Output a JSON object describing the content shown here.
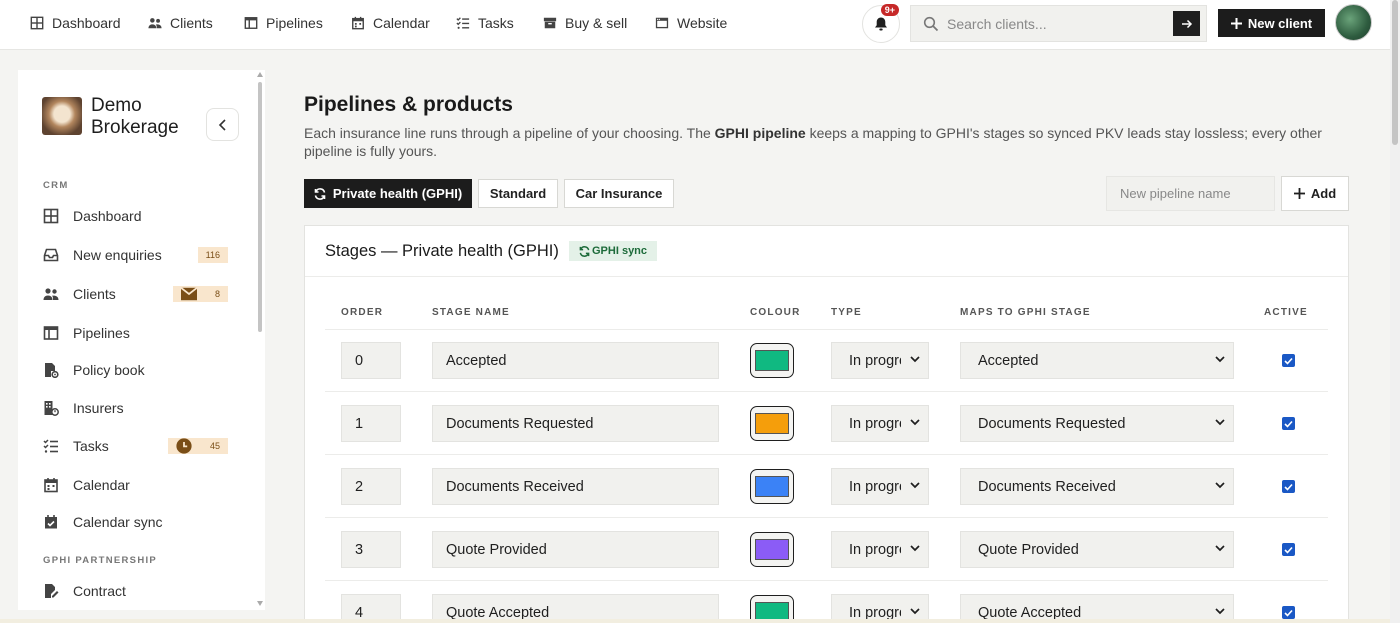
{
  "nav": {
    "items": [
      {
        "label": "Dashboard",
        "icon": "grid-icon"
      },
      {
        "label": "Clients",
        "icon": "users-icon"
      },
      {
        "label": "Pipelines",
        "icon": "columns-icon"
      },
      {
        "label": "Calendar",
        "icon": "calendar-icon"
      },
      {
        "label": "Tasks",
        "icon": "checklist-icon"
      },
      {
        "label": "Buy & sell",
        "icon": "box-icon"
      },
      {
        "label": "Website",
        "icon": "browser-icon"
      }
    ],
    "notification_badge": "9+",
    "search_placeholder": "Search clients...",
    "new_client_label": "New client"
  },
  "sidebar": {
    "brand_line1": "Demo",
    "brand_line2": "Brokerage",
    "section_crm": "CRM",
    "items": [
      {
        "label": "Dashboard",
        "icon": "grid-icon"
      },
      {
        "label": "New enquiries",
        "icon": "inbox-icon",
        "badge": "116"
      },
      {
        "label": "Clients",
        "icon": "users-icon",
        "badge": "8",
        "badge_icon": "mail-icon"
      },
      {
        "label": "Pipelines",
        "icon": "columns-icon"
      },
      {
        "label": "Policy book",
        "icon": "file-gear-icon"
      },
      {
        "label": "Insurers",
        "icon": "building-icon"
      },
      {
        "label": "Tasks",
        "icon": "checklist-icon",
        "badge": "45",
        "badge_icon": "clock-icon"
      },
      {
        "label": "Calendar",
        "icon": "calendar-icon"
      },
      {
        "label": "Calendar sync",
        "icon": "calendar-check-icon"
      }
    ],
    "section_partner": "GPHI PARTNERSHIP",
    "partner_items": [
      {
        "label": "Contract",
        "icon": "file-signature-icon"
      }
    ]
  },
  "page": {
    "title": "Pipelines & products",
    "desc_before": "Each insurance line runs through a pipeline of your choosing. The ",
    "desc_bold": "GPHI pipeline",
    "desc_after": " keeps a mapping to GPHI's stages so synced PKV leads stay lossless; every other pipeline is fully yours.",
    "tabs": [
      {
        "label": "Private health (GPHI)",
        "active": true
      },
      {
        "label": "Standard",
        "active": false
      },
      {
        "label": "Car Insurance",
        "active": false
      }
    ],
    "new_pipeline_placeholder": "New pipeline name",
    "add_label": "Add"
  },
  "stages": {
    "title": "Stages — Private health (GPHI)",
    "sync_badge": "GPHI sync",
    "columns": [
      "ORDER",
      "STAGE NAME",
      "COLOUR",
      "TYPE",
      "MAPS TO GPHI STAGE",
      "ACTIVE"
    ],
    "rows": [
      {
        "order": "0",
        "name": "Accepted",
        "colour": "#10b981",
        "type": "In progress",
        "maps_to": "Accepted",
        "active": true
      },
      {
        "order": "1",
        "name": "Documents Requested",
        "colour": "#f59e0b",
        "type": "In progress",
        "maps_to": "Documents Requested",
        "active": true
      },
      {
        "order": "2",
        "name": "Documents Received",
        "colour": "#3b82f6",
        "type": "In progress",
        "maps_to": "Documents Received",
        "active": true
      },
      {
        "order": "3",
        "name": "Quote Provided",
        "colour": "#8b5cf6",
        "type": "In progress",
        "maps_to": "Quote Provided",
        "active": true
      },
      {
        "order": "4",
        "name": "Quote Accepted",
        "colour": "#10b981",
        "type": "In progress",
        "maps_to": "Quote Accepted",
        "active": true
      }
    ]
  }
}
